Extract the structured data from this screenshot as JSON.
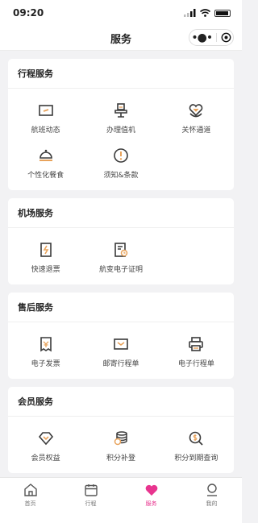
{
  "status_bar": {
    "time": "09:20"
  },
  "header": {
    "title": "服务"
  },
  "sections": [
    {
      "title": "行程服务",
      "items": [
        {
          "label": "航班动态",
          "icon": "flight-status-icon"
        },
        {
          "label": "办理值机",
          "icon": "check-in-icon"
        },
        {
          "label": "关怀通道",
          "icon": "care-channel-icon"
        },
        {
          "label": "个性化餐食",
          "icon": "meal-icon"
        },
        {
          "label": "须知&条款",
          "icon": "notice-icon"
        }
      ]
    },
    {
      "title": "机场服务",
      "items": [
        {
          "label": "快速退票",
          "icon": "refund-icon"
        },
        {
          "label": "航变电子证明",
          "icon": "certificate-icon"
        }
      ]
    },
    {
      "title": "售后服务",
      "items": [
        {
          "label": "电子发票",
          "icon": "invoice-icon"
        },
        {
          "label": "邮寄行程单",
          "icon": "mail-icon"
        },
        {
          "label": "电子行程单",
          "icon": "printer-icon"
        }
      ]
    },
    {
      "title": "会员服务",
      "items": [
        {
          "label": "会员权益",
          "icon": "diamond-icon"
        },
        {
          "label": "积分补登",
          "icon": "coins-icon"
        },
        {
          "label": "积分到期查询",
          "icon": "points-query-icon"
        }
      ]
    }
  ],
  "tabs": [
    {
      "label": "首页",
      "icon": "home-icon"
    },
    {
      "label": "行程",
      "icon": "calendar-icon"
    },
    {
      "label": "服务",
      "icon": "heart-icon"
    },
    {
      "label": "我的",
      "icon": "profile-icon"
    }
  ],
  "colors": {
    "accent": "#e8358f",
    "icon_stroke": "#3a3a3a",
    "icon_highlight": "#e8a35c"
  }
}
